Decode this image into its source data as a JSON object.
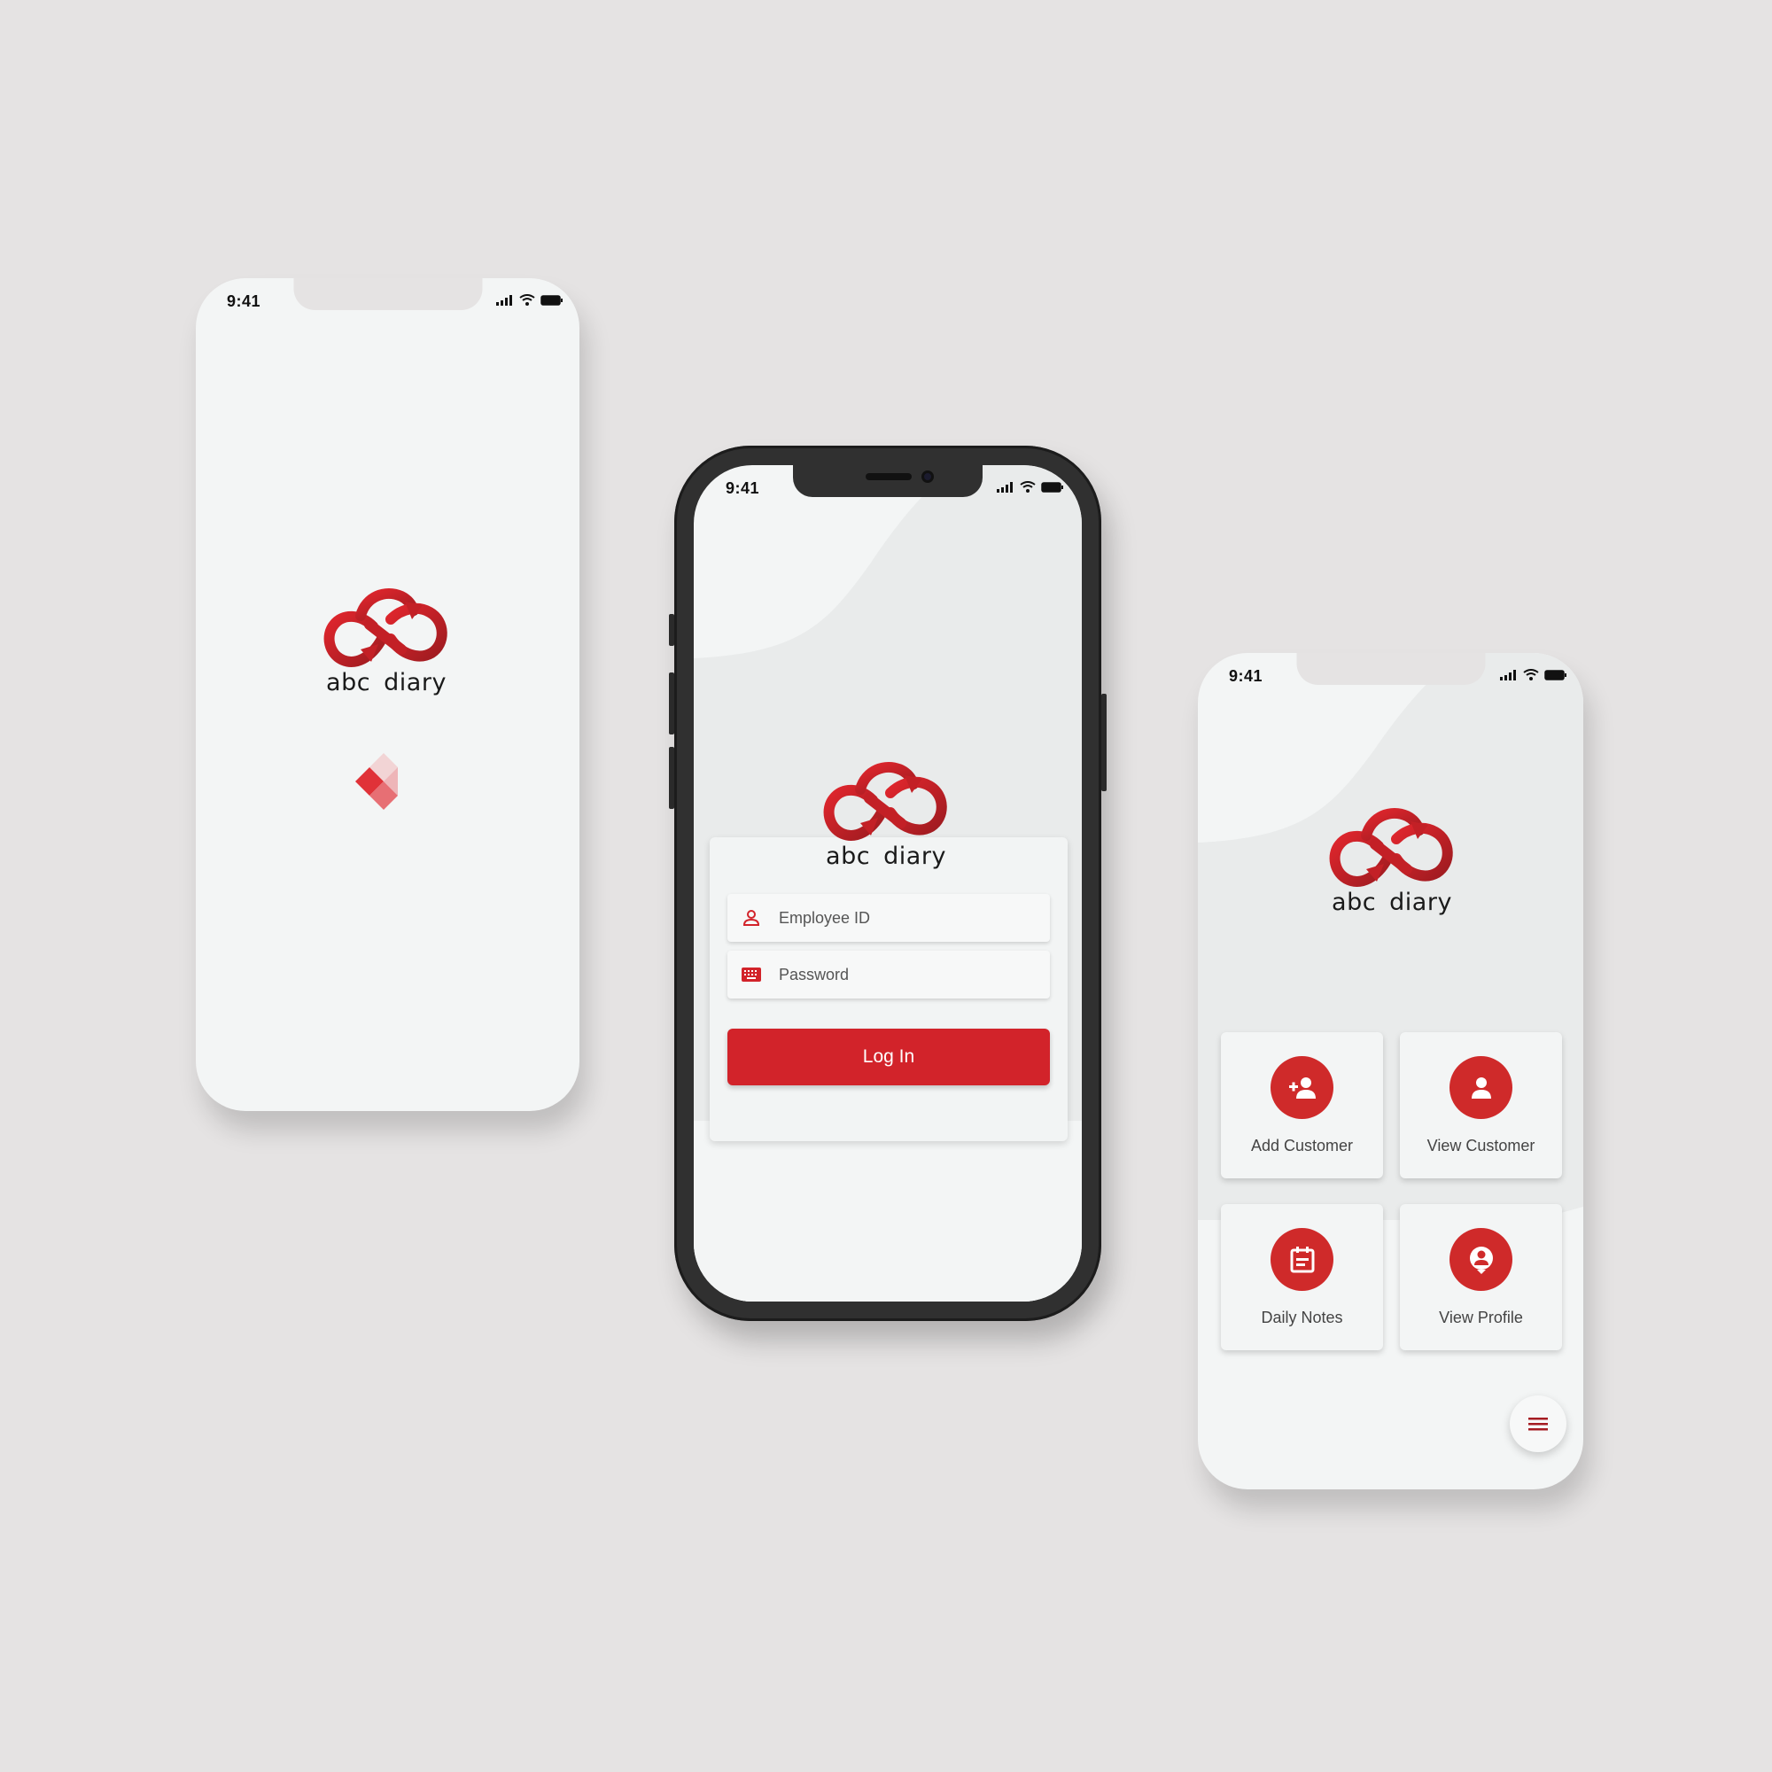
{
  "brand": {
    "name": "abc diary",
    "primary_color": "#d2232a",
    "dark_red": "#a51c22"
  },
  "status_bar": {
    "time": "9:41"
  },
  "splash": {
    "loader_icon": "diamond-loader-icon"
  },
  "login": {
    "employee_id_placeholder": "Employee ID",
    "password_placeholder": "Password",
    "login_button": "Log In"
  },
  "dashboard": {
    "tiles": [
      {
        "label": "Add Customer",
        "icon": "add-person-icon"
      },
      {
        "label": "View Customer",
        "icon": "person-icon"
      },
      {
        "label": "Daily Notes",
        "icon": "calendar-notes-icon"
      },
      {
        "label": "View Profile",
        "icon": "profile-badge-icon"
      }
    ],
    "menu_icon": "hamburger-menu-icon"
  }
}
